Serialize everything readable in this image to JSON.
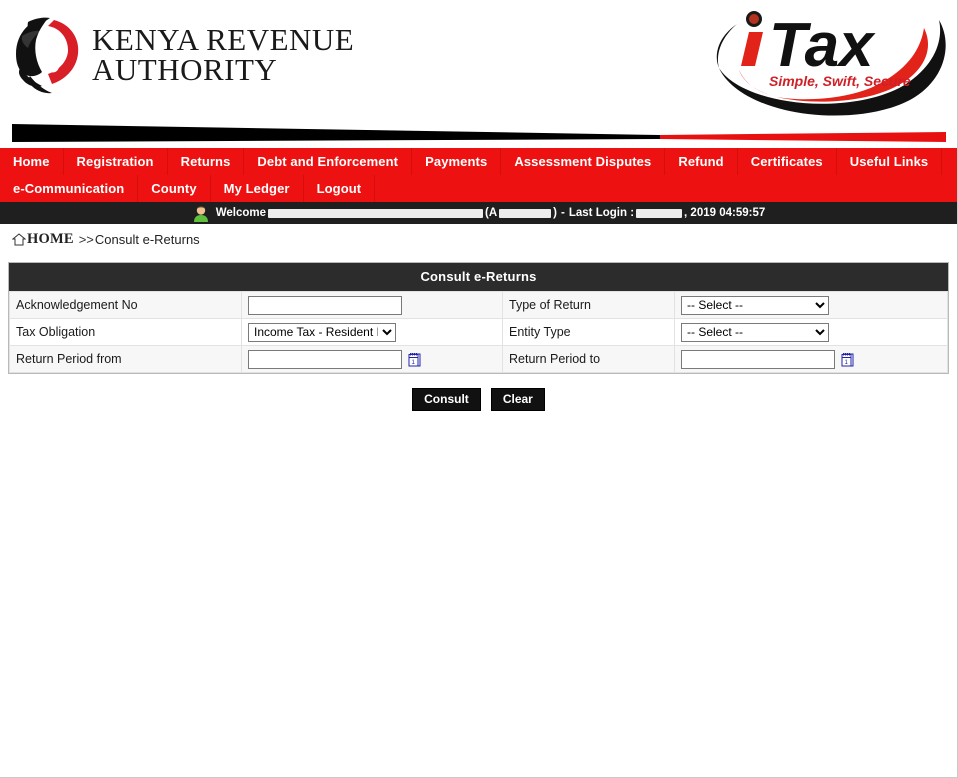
{
  "brand": {
    "kra_line1": "KENYA REVENUE",
    "kra_line2": "AUTHORITY",
    "itax_word": "Tax",
    "itax_i": "i",
    "itax_tagline": "Simple, Swift, Secure"
  },
  "nav": {
    "row1": [
      {
        "label": "Home"
      },
      {
        "label": "Registration"
      },
      {
        "label": "Returns"
      },
      {
        "label": "Debt and Enforcement"
      },
      {
        "label": "Payments"
      },
      {
        "label": "Assessment Disputes"
      },
      {
        "label": "Refund"
      },
      {
        "label": "Certificates"
      },
      {
        "label": "Useful Links"
      }
    ],
    "row2": [
      {
        "label": "e-Communication"
      },
      {
        "label": "County"
      },
      {
        "label": "My Ledger"
      },
      {
        "label": "Logout"
      }
    ]
  },
  "welcome": {
    "icon": "user-avatar-icon",
    "prefix": "Welcome",
    "name_redacted": "",
    "pin_open": "(A",
    "pin_redacted": "",
    "pin_close": ")",
    "separator": "-",
    "last_login_label": "Last Login :",
    "last_login_date_redacted": "",
    "last_login_value": ", 2019 04:59:57"
  },
  "breadcrumb": {
    "home_icon": "home-icon",
    "home": "HOME",
    "separator": ">>",
    "current": "Consult e-Returns"
  },
  "panel": {
    "title": "Consult e-Returns",
    "fields": {
      "acknowledgement_no": {
        "label": "Acknowledgement No",
        "value": "",
        "placeholder": ""
      },
      "type_of_return": {
        "label": "Type of Return",
        "value": "-- Select --",
        "options": [
          "-- Select --"
        ]
      },
      "tax_obligation": {
        "label": "Tax Obligation",
        "value": "Income Tax - Resident Individual",
        "options": [
          "Income Tax - Resident Individual"
        ]
      },
      "entity_type": {
        "label": "Entity Type",
        "value": "-- Select --",
        "options": [
          "-- Select --"
        ]
      },
      "return_period_from": {
        "label": "Return Period from",
        "value": "",
        "placeholder": "",
        "calendar_icon": "calendar-icon"
      },
      "return_period_to": {
        "label": "Return Period to",
        "value": "",
        "placeholder": "",
        "calendar_icon": "calendar-icon"
      }
    }
  },
  "actions": {
    "consult": "Consult",
    "clear": "Clear"
  },
  "colors": {
    "nav_red": "#ee1111",
    "panel_header": "#2c2c2c",
    "welcome_bar": "#1f1f1f",
    "button_bg": "#111111",
    "brand_red": "#e2231a"
  }
}
